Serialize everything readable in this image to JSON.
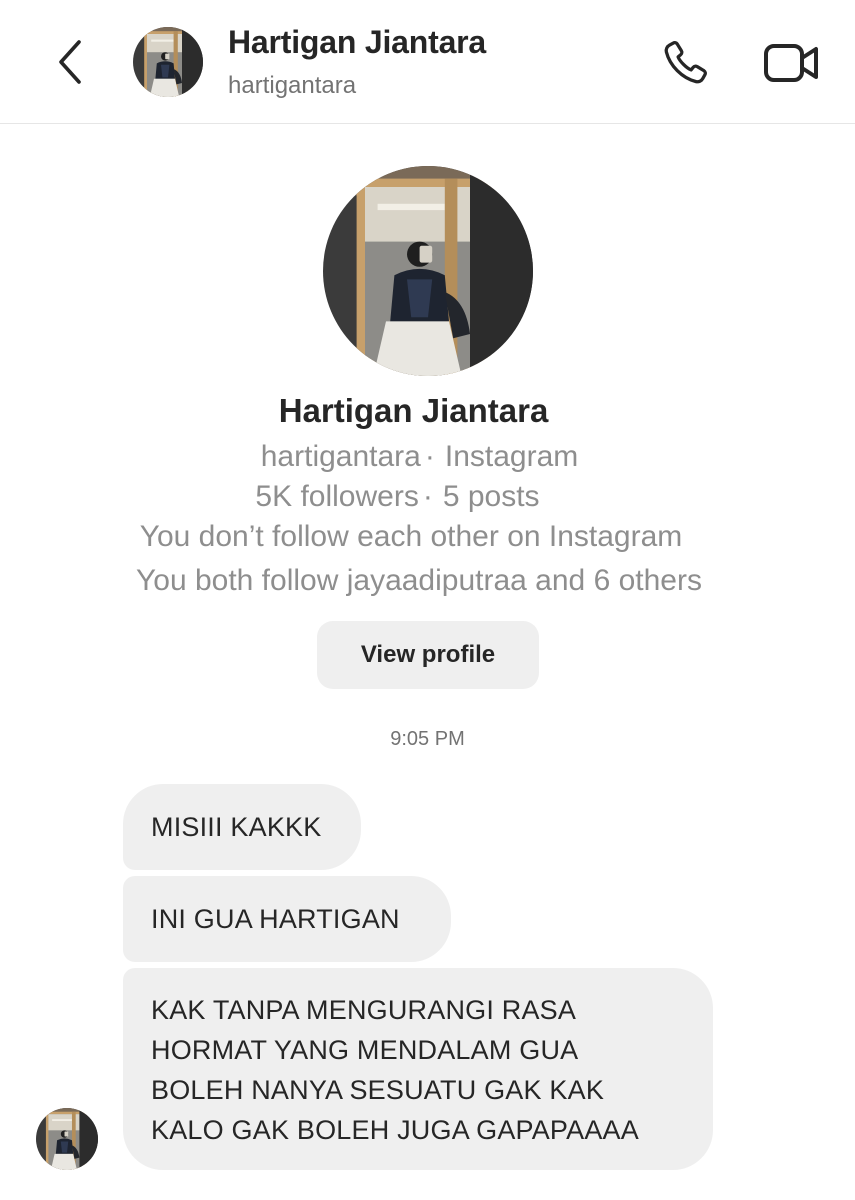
{
  "header": {
    "name": "Hartigan Jiantara",
    "username": "hartigantara",
    "back_icon": "chevron-left-icon",
    "call_icon": "phone-icon",
    "video_icon": "video-camera-icon"
  },
  "profile": {
    "name": "Hartigan Jiantara",
    "username": "hartigantara",
    "platform": "Instagram",
    "followers": "5K followers",
    "posts": "5 posts",
    "dot": "·",
    "follow_status": "You don’t follow each other on Instagram",
    "mutuals": "You both follow jayaadiputraa and 6 others",
    "view_profile_label": "View profile"
  },
  "thread": {
    "timestamp": "9:05 PM",
    "messages": [
      {
        "lines": [
          "MISIII KAKKK"
        ]
      },
      {
        "lines": [
          "INI GUA HARTIGAN"
        ]
      },
      {
        "lines": [
          "KAK TANPA MENGURANGI RASA",
          "HORMAT YANG MENDALAM GUA",
          "BOLEH NANYA SESUATU GAK KAK",
          "KALO GAK BOLEH JUGA GAPAPAAAA"
        ]
      }
    ]
  },
  "colors": {
    "bubble": "#efefef",
    "primary_text": "#262626",
    "secondary_text": "#8e8e8e",
    "divider": "#e6e6e6"
  }
}
